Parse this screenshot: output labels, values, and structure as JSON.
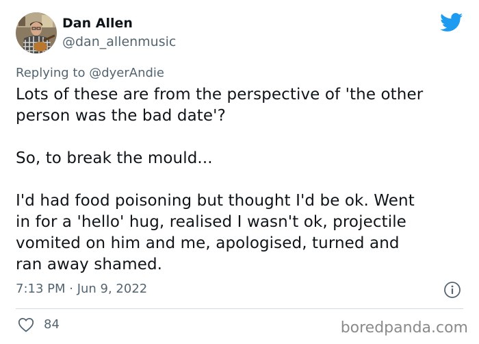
{
  "author": {
    "display_name": "Dan Allen",
    "handle": "@dan_allenmusic",
    "avatar_icon": "profile-photo-guitar"
  },
  "reply": {
    "label": "Replying to",
    "target": "@dyerAndie"
  },
  "tweet": {
    "lines": [
      "Lots of these are from the perspective of 'the other",
      "person was the bad date'?",
      "",
      "So, to break the mould...",
      "",
      "I'd had food poisoning but thought I'd be ok. Went",
      "in for a 'hello' hug, realised I wasn't ok, projectile",
      "vomited on him and me, apologised, turned and",
      "ran away shamed."
    ]
  },
  "meta": {
    "timestamp": "7:13 PM · Jun 9, 2022"
  },
  "engagement": {
    "likes": "84"
  },
  "watermark": "boredpanda.com",
  "colors": {
    "twitter_blue": "#1d9bf0",
    "text": "#0f1419",
    "secondary": "#536471",
    "divider": "#cfd9de"
  },
  "icons": {
    "brand": "twitter-bird-icon",
    "info": "info-icon",
    "like": "heart-icon"
  }
}
